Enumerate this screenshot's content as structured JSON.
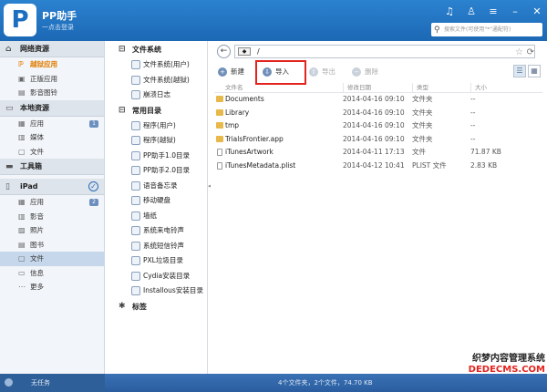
{
  "app": {
    "title": "PP助手",
    "subtitle": "一点击登录",
    "logo_letter": "P",
    "search_placeholder": "搜索文件(可使用\"*\"通配符)"
  },
  "window_buttons": [
    "music-icon",
    "shirt-icon",
    "menu-icon",
    "minimize-icon",
    "close-icon"
  ],
  "sidebar": {
    "groups": [
      {
        "title": "网络资源",
        "icon": "house-icon",
        "items": [
          {
            "label": "越狱应用",
            "icon": "pp-icon",
            "active": true
          },
          {
            "label": "正版应用",
            "icon": "app-icon"
          },
          {
            "label": "影音图铃",
            "icon": "media-icon"
          }
        ]
      },
      {
        "title": "本地资源",
        "icon": "computer-icon",
        "items": [
          {
            "label": "应用",
            "icon": "grid-icon",
            "badge": "1"
          },
          {
            "label": "媒体",
            "icon": "film-icon"
          },
          {
            "label": "文件",
            "icon": "folder-icon"
          }
        ]
      },
      {
        "title": "工具箱",
        "icon": "toolbox-icon",
        "items": []
      },
      {
        "title": "iPad",
        "icon": "ipad-icon",
        "check": "✓",
        "items": [
          {
            "label": "应用",
            "icon": "grid-icon",
            "badge": "2"
          },
          {
            "label": "影音",
            "icon": "film-icon"
          },
          {
            "label": "照片",
            "icon": "photo-icon"
          },
          {
            "label": "图书",
            "icon": "book-icon"
          },
          {
            "label": "文件",
            "icon": "folder-icon",
            "selected": true
          },
          {
            "label": "信息",
            "icon": "message-icon"
          },
          {
            "label": "更多",
            "icon": "more-icon"
          }
        ]
      }
    ]
  },
  "tree": {
    "sections": [
      {
        "title": "文件系统",
        "items": [
          "文件系统(用户)",
          "文件系统(越狱)",
          "崩溃日志"
        ]
      },
      {
        "title": "常用目录",
        "items": [
          "程序(用户)",
          "程序(越狱)",
          "PP助手1.0目录",
          "PP助手2.0目录",
          "语音备忘录",
          "移动硬盘",
          "墙纸",
          "系统来电铃声",
          "系统短信铃声",
          "PXL垃圾目录",
          "Cydia安装目录",
          "Installous安装目录"
        ]
      },
      {
        "title": "标签",
        "items": []
      }
    ]
  },
  "pathbar": {
    "path": "/",
    "device": "◆"
  },
  "toolbar": {
    "new_label": "新建",
    "import_label": "导入",
    "export_label": "导出",
    "delete_label": "删除"
  },
  "table": {
    "headers": [
      "文件名",
      "修改日期",
      "类型",
      "大小"
    ],
    "rows": [
      {
        "name": "Documents",
        "date": "2014-04-16 09:10",
        "type": "文件夹",
        "size": "--",
        "kind": "folder"
      },
      {
        "name": "Library",
        "date": "2014-04-16 09:10",
        "type": "文件夹",
        "size": "--",
        "kind": "folder"
      },
      {
        "name": "tmp",
        "date": "2014-04-16 09:10",
        "type": "文件夹",
        "size": "--",
        "kind": "folder"
      },
      {
        "name": "TrialsFrontier.app",
        "date": "2014-04-16 09:10",
        "type": "文件夹",
        "size": "--",
        "kind": "folder"
      },
      {
        "name": "iTunesArtwork",
        "date": "2014-04-11 17:13",
        "type": "文件",
        "size": "71.87 KB",
        "kind": "file"
      },
      {
        "name": "iTunesMetadata.plist",
        "date": "2014-04-12 10:41",
        "type": "PLIST 文件",
        "size": "2.83 KB",
        "kind": "file"
      }
    ]
  },
  "status": {
    "tasks": "无任务",
    "summary": "4个文件夹，2个文件，74.70 KB",
    "watermark_line1": "织梦内容管理系统",
    "watermark_line2": "DEDECMS.COM"
  },
  "colors": {
    "titlebar": "#1c68b5",
    "accent_orange": "#e07c00",
    "highlight_red": "#e3231d",
    "folder": "#e8b94a"
  }
}
